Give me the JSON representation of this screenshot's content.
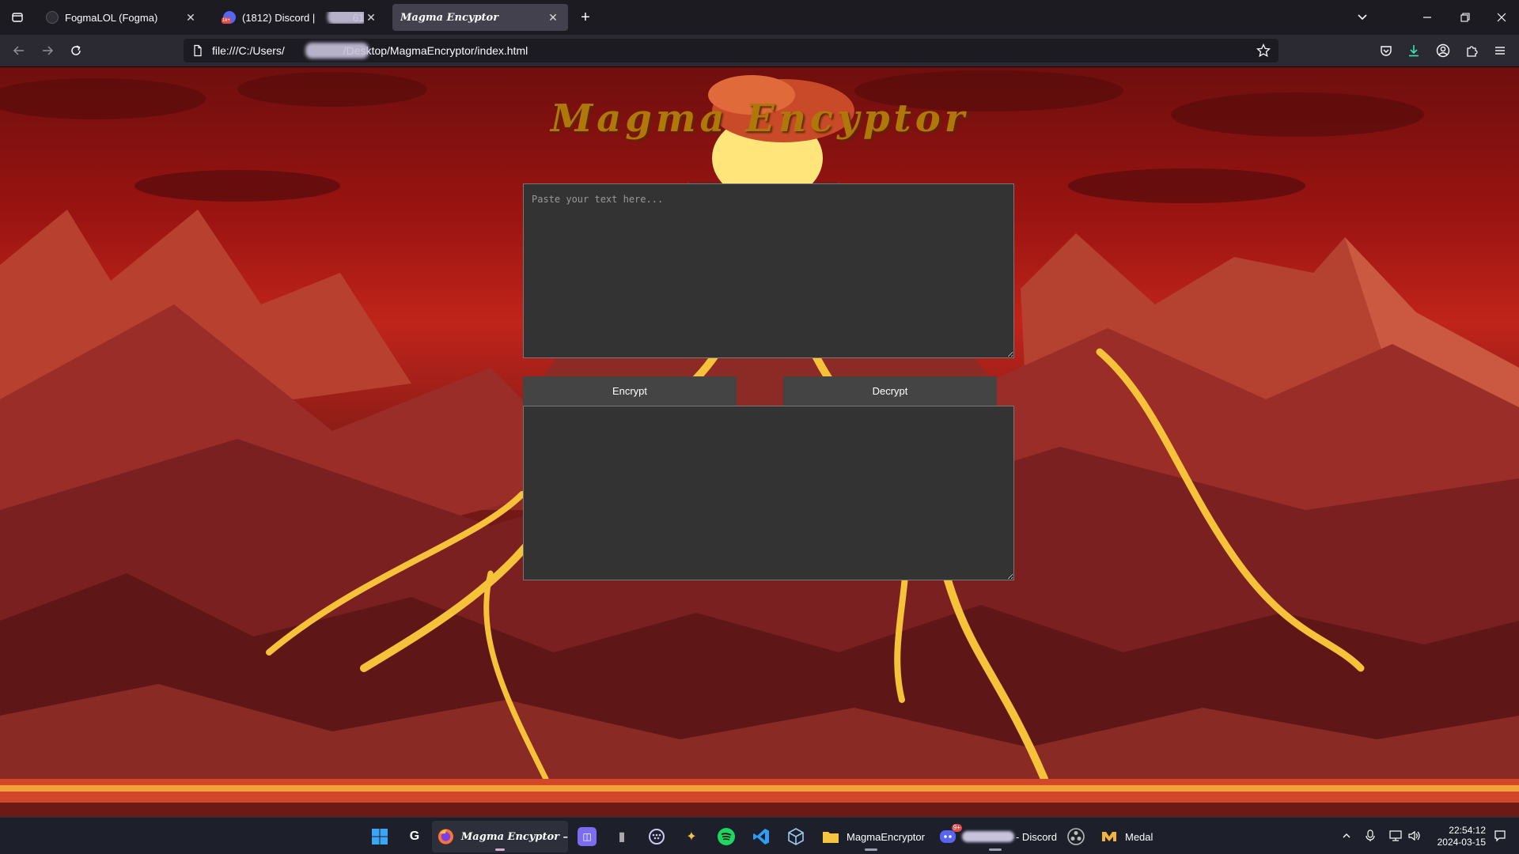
{
  "browser": {
    "tabs": [
      {
        "title": "FogmaLOL (Fogma)",
        "active": false
      },
      {
        "title": "(1812) Discord | ",
        "title_suffix": "61",
        "badge": "1k+",
        "active": false
      },
      {
        "title": "Magma Encyptor",
        "active": true
      }
    ],
    "url": "file:///C:/Users/",
    "url_suffix": "/Desktop/MagmaEncryptor/index.html"
  },
  "app": {
    "title": "Magma Encyptor",
    "input_placeholder": "Paste your text here...",
    "input_value": "",
    "output_value": "",
    "encrypt_label": "Encrypt",
    "decrypt_label": "Decrypt"
  },
  "taskbar": {
    "items": [
      {
        "name": "start-button",
        "label": "",
        "icon": "windows-icon"
      },
      {
        "name": "logitech-app",
        "label": "",
        "icon": "logitech-icon"
      },
      {
        "name": "firefox-window",
        "label": "Magma Encyptor –",
        "icon": "firefox-icon",
        "active": true
      },
      {
        "name": "app-launcher",
        "label": "",
        "icon": "app-icon"
      },
      {
        "name": "terminal-app",
        "label": "",
        "icon": "terminal-icon"
      },
      {
        "name": "keypad-app",
        "label": "",
        "icon": "dial-icon"
      },
      {
        "name": "wand-app",
        "label": "",
        "icon": "wand-icon"
      },
      {
        "name": "spotify-app",
        "label": "",
        "icon": "spotify-icon"
      },
      {
        "name": "vscode-app",
        "label": "",
        "icon": "vscode-icon"
      },
      {
        "name": "box-app",
        "label": "",
        "icon": "box-icon"
      },
      {
        "name": "explorer-window",
        "label": "MagmaEncryptor",
        "icon": "folder-icon"
      },
      {
        "name": "discord-window",
        "label": "- Discord",
        "icon": "discord-icon",
        "badge": "9+"
      },
      {
        "name": "obs-app",
        "label": "",
        "icon": "obs-icon"
      },
      {
        "name": "medal-window",
        "label": "Medal",
        "icon": "medal-icon"
      }
    ],
    "time": "22:54:12",
    "date": "2024-03-15"
  },
  "colors": {
    "title": "#b0780a",
    "textarea_bg": "#333333",
    "button_bg": "#444444",
    "lava": "#f6c23a"
  }
}
